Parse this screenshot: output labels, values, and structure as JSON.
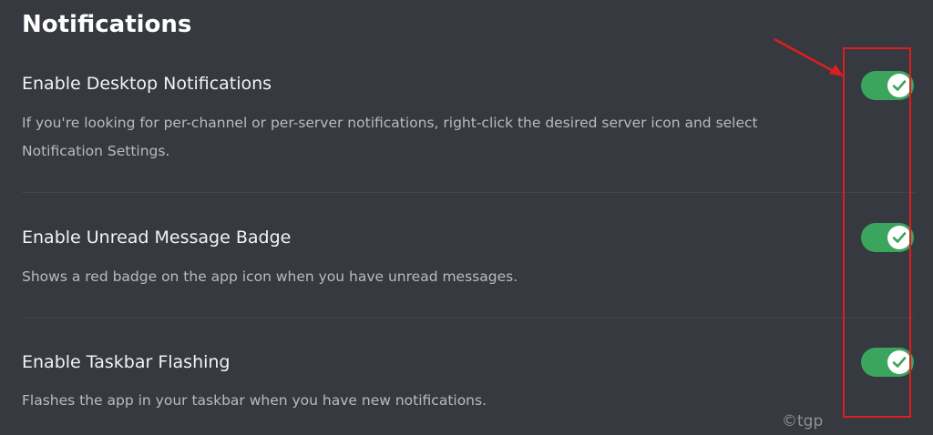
{
  "section": {
    "title": "Notifications"
  },
  "settings": [
    {
      "label": "Enable Desktop Notifications",
      "description": "If you're looking for per-channel or per-server notifications, right-click the desired server icon and select Notification Settings.",
      "enabled": true
    },
    {
      "label": "Enable Unread Message Badge",
      "description": "Shows a red badge on the app icon when you have unread messages.",
      "enabled": true
    },
    {
      "label": "Enable Taskbar Flashing",
      "description": "Flashes the app in your taskbar when you have new notifications.",
      "enabled": true
    }
  ],
  "watermark": "©tgp",
  "icons": {
    "toggle": "checkmark-icon",
    "annotation": "red-arrow"
  },
  "colors": {
    "background": "#36393f",
    "toggle_on": "#3ba55d",
    "annotation": "#e01e1e"
  }
}
